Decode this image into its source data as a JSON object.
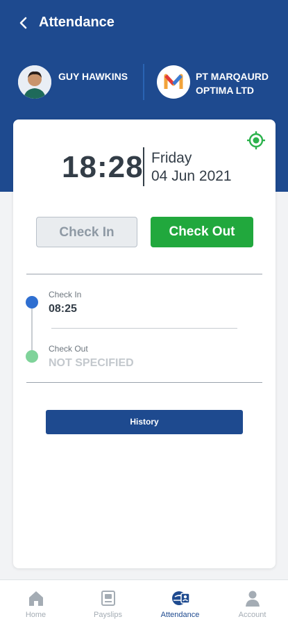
{
  "header": {
    "title": "Attendance",
    "user_name": "GUY HAWKINS",
    "company_name": "PT MARQAURD OPTIMA LTD",
    "icons": {
      "back": "chevron-left-icon",
      "avatar": "user-avatar",
      "logo": "company-logo"
    }
  },
  "clock": {
    "time": "18:28",
    "day": "Friday",
    "date": "04 Jun 2021",
    "location_icon": "location-target-icon"
  },
  "actions": {
    "check_in_label": "Check In",
    "check_out_label": "Check Out",
    "history_label": "History"
  },
  "timeline": {
    "check_in_label": "Check In",
    "check_in_time": "08:25",
    "check_out_label": "Check Out",
    "check_out_value": "NOT SPECIFIED"
  },
  "nav": {
    "items": [
      {
        "label": "Home",
        "icon": "home-icon",
        "active": false
      },
      {
        "label": "Payslips",
        "icon": "payslip-icon",
        "active": false
      },
      {
        "label": "Attendance",
        "icon": "attendance-icon",
        "active": true
      },
      {
        "label": "Account",
        "icon": "account-icon",
        "active": false
      }
    ]
  },
  "colors": {
    "primary": "#1e4a8f",
    "success": "#21a83d",
    "location": "#2bb24c",
    "timeline_in": "#2f6fd1",
    "timeline_out": "#7fd39a"
  }
}
